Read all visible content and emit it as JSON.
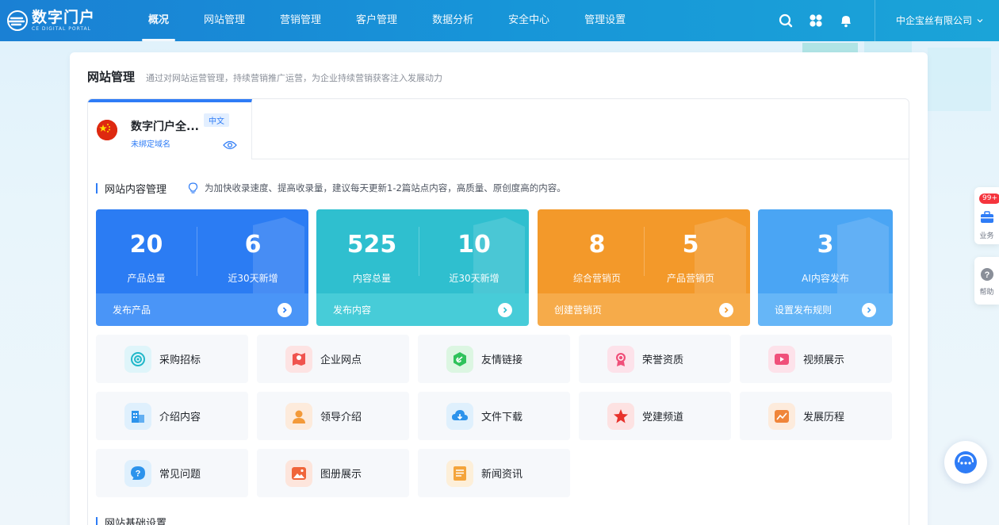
{
  "brand": {
    "name_cn": "数字门户",
    "name_en": "CE DIGITAL PORTAL"
  },
  "nav": [
    "概况",
    "网站管理",
    "营销管理",
    "客户管理",
    "数据分析",
    "安全中心",
    "管理设置"
  ],
  "company": "中企宝丝有限公司",
  "page": {
    "title": "网站管理",
    "desc": "通过对网站运营管理，持续营销推广运营，为企业持续营销获客注入发展动力"
  },
  "site": {
    "name": "数字门户全...",
    "lang": "中文",
    "domain": "未绑定域名"
  },
  "content_section": {
    "title": "网站内容管理",
    "tip": "为加快收录速度、提高收录量，建议每天更新1-2篇站点内容，高质量、原创度高的内容。"
  },
  "stats": [
    {
      "a_value": "20",
      "a_label": "产品总量",
      "b_value": "6",
      "b_label": "近30天新增",
      "action": "发布产品",
      "color": "#2b7cf3",
      "color2": "#4a95f7"
    },
    {
      "a_value": "525",
      "a_label": "内容总量",
      "b_value": "10",
      "b_label": "近30天新增",
      "action": "发布内容",
      "color": "#2fbfcf",
      "color2": "#47ccd8"
    },
    {
      "a_value": "8",
      "a_label": "综合营销页",
      "b_value": "5",
      "b_label": "产品营销页",
      "action": "创建营销页",
      "color": "#f3992a",
      "color2": "#f6ab4a"
    },
    {
      "a_value": "3",
      "a_label": "AI内容发布",
      "action": "设置发布规则",
      "color": "#4aa5f4",
      "color2": "#66b6f7"
    }
  ],
  "tiles": [
    {
      "label": "采购招标",
      "icon": "target-icon",
      "bg": "#dff5fa",
      "fg": "#1fb7c9"
    },
    {
      "label": "企业网点",
      "icon": "map-pin-icon",
      "bg": "#fde3e3",
      "fg": "#f0534e"
    },
    {
      "label": "友情链接",
      "icon": "link-icon",
      "bg": "#dcf6e2",
      "fg": "#2fc25b"
    },
    {
      "label": "荣誉资质",
      "icon": "medal-icon",
      "bg": "#fde2ea",
      "fg": "#f0507a"
    },
    {
      "label": "视频展示",
      "icon": "video-icon",
      "bg": "#fde2ea",
      "fg": "#f0507a"
    },
    {
      "label": "介绍内容",
      "icon": "building-icon",
      "bg": "#dff0fd",
      "fg": "#2c93ec"
    },
    {
      "label": "领导介绍",
      "icon": "person-icon",
      "bg": "#fdebdc",
      "fg": "#f39a3a"
    },
    {
      "label": "文件下载",
      "icon": "cloud-download-icon",
      "bg": "#dff0fd",
      "fg": "#2c93ec"
    },
    {
      "label": "党建频道",
      "icon": "party-star-icon",
      "bg": "#fde2e2",
      "fg": "#e8322b"
    },
    {
      "label": "发展历程",
      "icon": "chart-icon",
      "bg": "#fdebdc",
      "fg": "#f0853a"
    },
    {
      "label": "常见问题",
      "icon": "question-icon",
      "bg": "#dff0fd",
      "fg": "#2c93ec"
    },
    {
      "label": "图册展示",
      "icon": "image-icon",
      "bg": "#fde5dc",
      "fg": "#f0653a"
    },
    {
      "label": "新闻资讯",
      "icon": "news-icon",
      "bg": "#fdefd9",
      "fg": "#f4a43a"
    }
  ],
  "basic_section": {
    "title": "网站基础设置"
  },
  "side_float": {
    "badge": "99+",
    "business": "业务",
    "help": "帮助"
  }
}
